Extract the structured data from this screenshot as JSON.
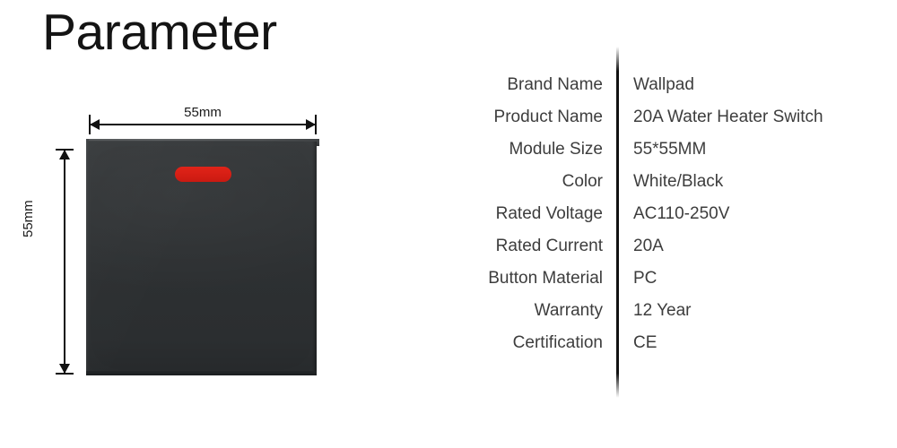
{
  "page": {
    "title": "Parameter",
    "background_color": "#ffffff",
    "text_color": "#3d3d3d"
  },
  "product_figure": {
    "name": "wall-switch-product-diagram",
    "body_color": "#2e3133",
    "bevel_color": "#4a4d4f",
    "indicator_color": "#d92018",
    "width_dimension": {
      "label": "55mm",
      "axis": "horizontal"
    },
    "height_dimension": {
      "label": "55mm",
      "axis": "vertical"
    }
  },
  "spec_table": {
    "divider_color": "#111111",
    "rows": [
      {
        "label": "Brand Name",
        "value": "Wallpad"
      },
      {
        "label": "Product Name",
        "value": "20A Water Heater Switch"
      },
      {
        "label": "Module Size",
        "value": "55*55MM"
      },
      {
        "label": "Color",
        "value": "White/Black"
      },
      {
        "label": "Rated Voltage",
        "value": "AC110-250V"
      },
      {
        "label": "Rated Current",
        "value": "20A"
      },
      {
        "label": "Button Material",
        "value": "PC"
      },
      {
        "label": "Warranty",
        "value": "12 Year"
      },
      {
        "label": "Certification",
        "value": "CE"
      }
    ]
  }
}
